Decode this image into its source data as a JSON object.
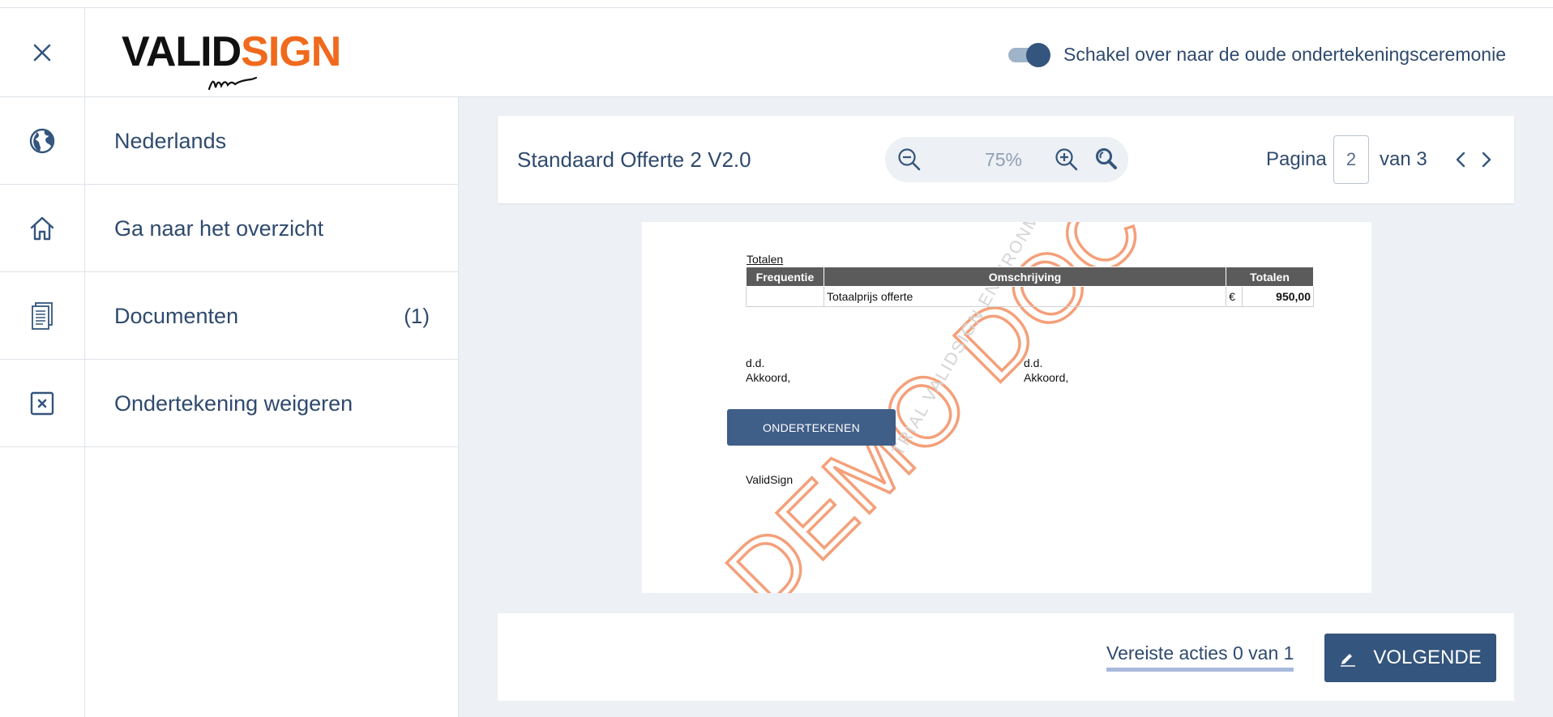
{
  "header": {
    "logo": {
      "part1": "VALID",
      "part2": "SIGN"
    },
    "toggle_label": "Schakel over naar de oude ondertekeningsceremonie",
    "toggle_on": true
  },
  "sidebar": {
    "items": [
      {
        "icon": "globe-icon",
        "label": "Nederlands"
      },
      {
        "icon": "home-icon",
        "label": "Ga naar het overzicht"
      },
      {
        "icon": "documents-icon",
        "label": "Documenten",
        "count": "(1)"
      },
      {
        "icon": "decline-icon",
        "label": "Ondertekening weigeren"
      }
    ]
  },
  "toolbar": {
    "document_title": "Standaard Offerte 2 V2.0",
    "zoom": "75%",
    "page_label": "Pagina",
    "current_page": "2",
    "of_label": "van 3"
  },
  "document": {
    "heading": "Totalen",
    "table": {
      "headers": [
        "Frequentie",
        "Omschrijving",
        "Totalen"
      ],
      "rows": [
        {
          "frequency": "",
          "description": "Totaalprijs offerte",
          "currency": "€",
          "amount": "950,00"
        }
      ]
    },
    "left_signature": {
      "line1": "d.d.",
      "line2": "Akkoord,"
    },
    "right_signature": {
      "line1": "d.d.",
      "line2": "Akkoord,"
    },
    "sign_button": "ONDERTEKENEN",
    "company": "ValidSign",
    "watermark_large": "DEMO DOCUMENT",
    "watermark_small": "TRIAL VALIDSIGN ENVIRONMENT"
  },
  "footer": {
    "required_actions": "Vereiste acties 0 van 1",
    "next_button": "VOLGENDE"
  },
  "colors": {
    "primary": "#34557d",
    "text": "#2f4a6e",
    "brand_orange": "#f06a1d",
    "background": "#edf0f4"
  }
}
